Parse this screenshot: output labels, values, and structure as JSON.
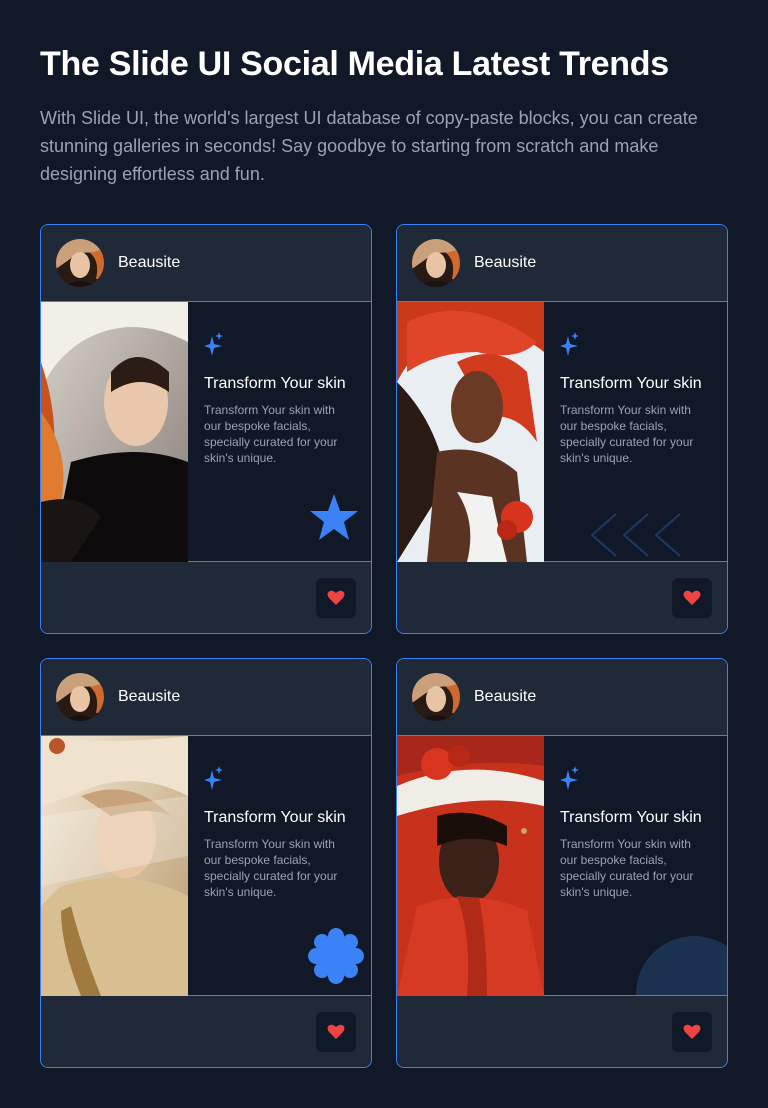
{
  "header": {
    "title": "The Slide UI Social Media Latest Trends",
    "subtitle": "With Slide UI, the world's largest UI database of copy-paste blocks, you can create stunning galleries in seconds! Say goodbye to starting from scratch and make designing effortless and fun."
  },
  "cards": [
    {
      "author": "Beausite",
      "title": "Transform Your skin",
      "text": "Transform Your skin with our bespoke facials, specially curated for your skin's unique.",
      "decoration": "star-shape",
      "like_icon": "heart-icon"
    },
    {
      "author": "Beausite",
      "title": "Transform Your skin",
      "text": "Transform Your skin with our bespoke facials, specially curated for your skin's unique.",
      "decoration": "chevrons-left-shape",
      "like_icon": "heart-icon"
    },
    {
      "author": "Beausite",
      "title": "Transform Your skin",
      "text": "Transform Your skin with our bespoke facials, specially curated for your skin's unique.",
      "decoration": "flower-shape",
      "like_icon": "heart-icon"
    },
    {
      "author": "Beausite",
      "title": "Transform Your skin",
      "text": "Transform Your skin with our bespoke facials, specially curated for your skin's unique.",
      "decoration": "circle-shape",
      "like_icon": "heart-icon"
    }
  ],
  "colors": {
    "background": "#111827",
    "panel": "#1f2937",
    "accent": "#3b82f6",
    "heart": "#ef4444",
    "muted_text": "#9ca3af"
  }
}
